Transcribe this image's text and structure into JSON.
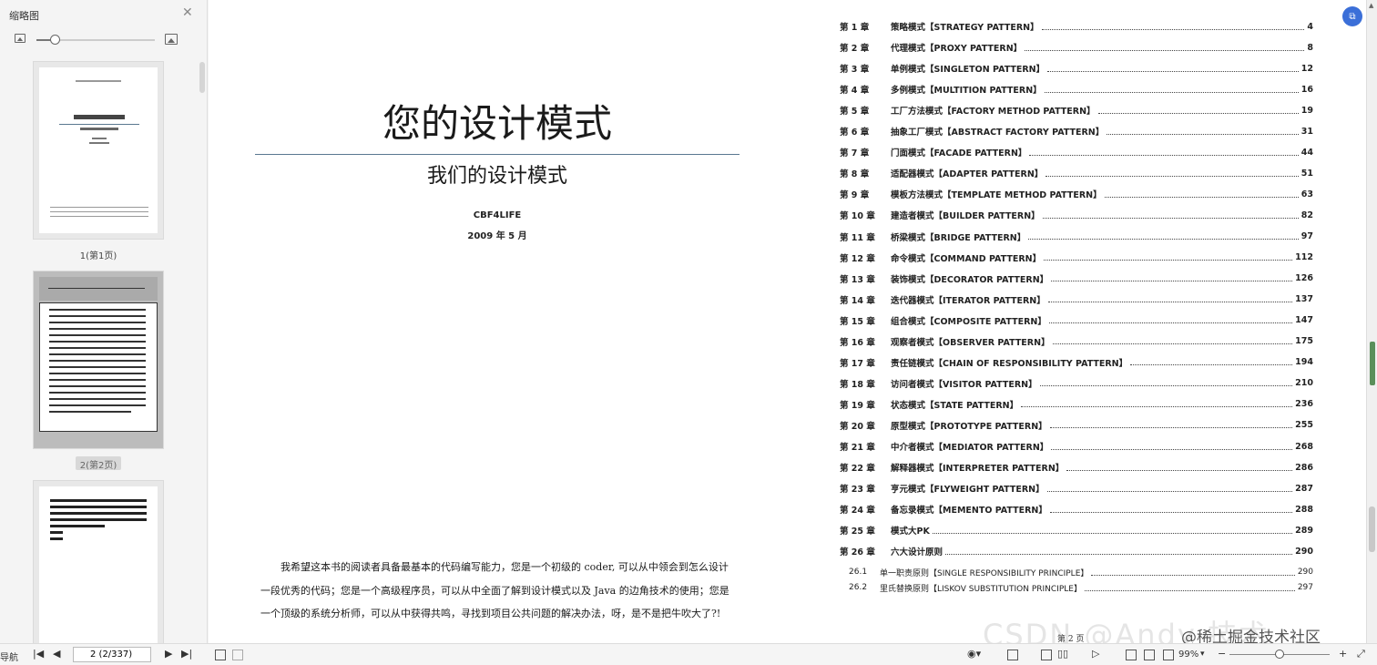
{
  "sidebar": {
    "title": "缩略图",
    "thumbnail_size_fraction": 0.15,
    "thumbnails": [
      {
        "label": "1(第1页)"
      },
      {
        "label": "2(第2页)"
      }
    ]
  },
  "document": {
    "cover_title": "您的设计模式",
    "cover_subtitle": "我们的设计模式",
    "author": "CBF4LIFE",
    "date": "2009 年 5 月",
    "intro_lines": [
      "我希望这本书的阅读者具备最基本的代码编写能力，您是一个初级的 coder, 可以从中领会到怎么设计",
      "一段优秀的代码；您是一个高级程序员，可以从中全面了解到设计模式以及 Java 的边角技术的使用；您是",
      "一个顶级的系统分析师，可以从中获得共鸣，寻找到项目公共问题的解决办法，呀，是不是把牛吹大了?!"
    ],
    "toc": [
      {
        "chapter": "第 1 章",
        "text": "策略模式【STRATEGY PATTERN】",
        "page": "4"
      },
      {
        "chapter": "第 2 章",
        "text": "代理模式【PROXY PATTERN】",
        "page": "8"
      },
      {
        "chapter": "第 3 章",
        "text": "单例模式【SINGLETON PATTERN】",
        "page": "12"
      },
      {
        "chapter": "第 4 章",
        "text": "多例模式【MULTITION PATTERN】",
        "page": "16"
      },
      {
        "chapter": "第 5 章",
        "text": "工厂方法模式【FACTORY METHOD PATTERN】",
        "page": "19"
      },
      {
        "chapter": "第 6 章",
        "text": "抽象工厂模式【ABSTRACT FACTORY PATTERN】",
        "page": "31"
      },
      {
        "chapter": "第 7 章",
        "text": "门面模式【FACADE PATTERN】",
        "page": "44"
      },
      {
        "chapter": "第 8 章",
        "text": "适配器模式【ADAPTER PATTERN】",
        "page": "51"
      },
      {
        "chapter": "第 9 章",
        "text": "模板方法模式【TEMPLATE METHOD PATTERN】",
        "page": "63"
      },
      {
        "chapter": "第 10 章",
        "text": "建造者模式【BUILDER PATTERN】",
        "page": "82"
      },
      {
        "chapter": "第 11 章",
        "text": "桥梁模式【BRIDGE PATTERN】",
        "page": "97"
      },
      {
        "chapter": "第 12 章",
        "text": "命令模式【COMMAND PATTERN】",
        "page": "112"
      },
      {
        "chapter": "第 13 章",
        "text": "装饰模式【DECORATOR PATTERN】",
        "page": "126"
      },
      {
        "chapter": "第 14 章",
        "text": "迭代器模式【ITERATOR PATTERN】",
        "page": "137"
      },
      {
        "chapter": "第 15 章",
        "text": "组合模式【COMPOSITE PATTERN】",
        "page": "147"
      },
      {
        "chapter": "第 16 章",
        "text": "观察者模式【OBSERVER PATTERN】",
        "page": "175"
      },
      {
        "chapter": "第 17 章",
        "text": "责任链模式【CHAIN OF RESPONSIBILITY PATTERN】",
        "page": "194"
      },
      {
        "chapter": "第 18 章",
        "text": "访问者模式【VISITOR PATTERN】",
        "page": "210"
      },
      {
        "chapter": "第 19 章",
        "text": "状态模式【STATE PATTERN】",
        "page": "236"
      },
      {
        "chapter": "第 20 章",
        "text": "原型模式【PROTOTYPE PATTERN】",
        "page": "255"
      },
      {
        "chapter": "第 21 章",
        "text": "中介者模式【MEDIATOR PATTERN】",
        "page": "268"
      },
      {
        "chapter": "第 22 章",
        "text": "解释器模式【INTERPRETER PATTERN】",
        "page": "286"
      },
      {
        "chapter": "第 23 章",
        "text": "亨元模式【FLYWEIGHT PATTERN】",
        "page": "287"
      },
      {
        "chapter": "第 24 章",
        "text": "备忘录模式【MEMENTO PATTERN】",
        "page": "288"
      },
      {
        "chapter": "第 25 章",
        "text": "模式大PK",
        "page": "289"
      },
      {
        "chapter": "第 26 章",
        "text": "六大设计原则",
        "page": "290"
      }
    ],
    "toc_sub": [
      {
        "chapter": "26.1",
        "text": "单一职责原则【SINGLE RESPONSIBILITY PRINCIPLE】",
        "page": "290"
      },
      {
        "chapter": "26.2",
        "text": "里氏替换原则【LISKOV SUBSTITUTION PRINCIPLE】",
        "page": "297"
      }
    ],
    "footer_page": "第 2 页",
    "watermark_faint": "CSDN @Andy 技术",
    "watermark": "@稀土掘金技术社区"
  },
  "statusbar": {
    "nav_label": "导航",
    "page_input": "2 (2/337)",
    "zoom": "99%",
    "zoom_fraction": 0.5
  },
  "icons": {
    "float_button": "translate-icon",
    "accent": "#3b6fd8"
  }
}
